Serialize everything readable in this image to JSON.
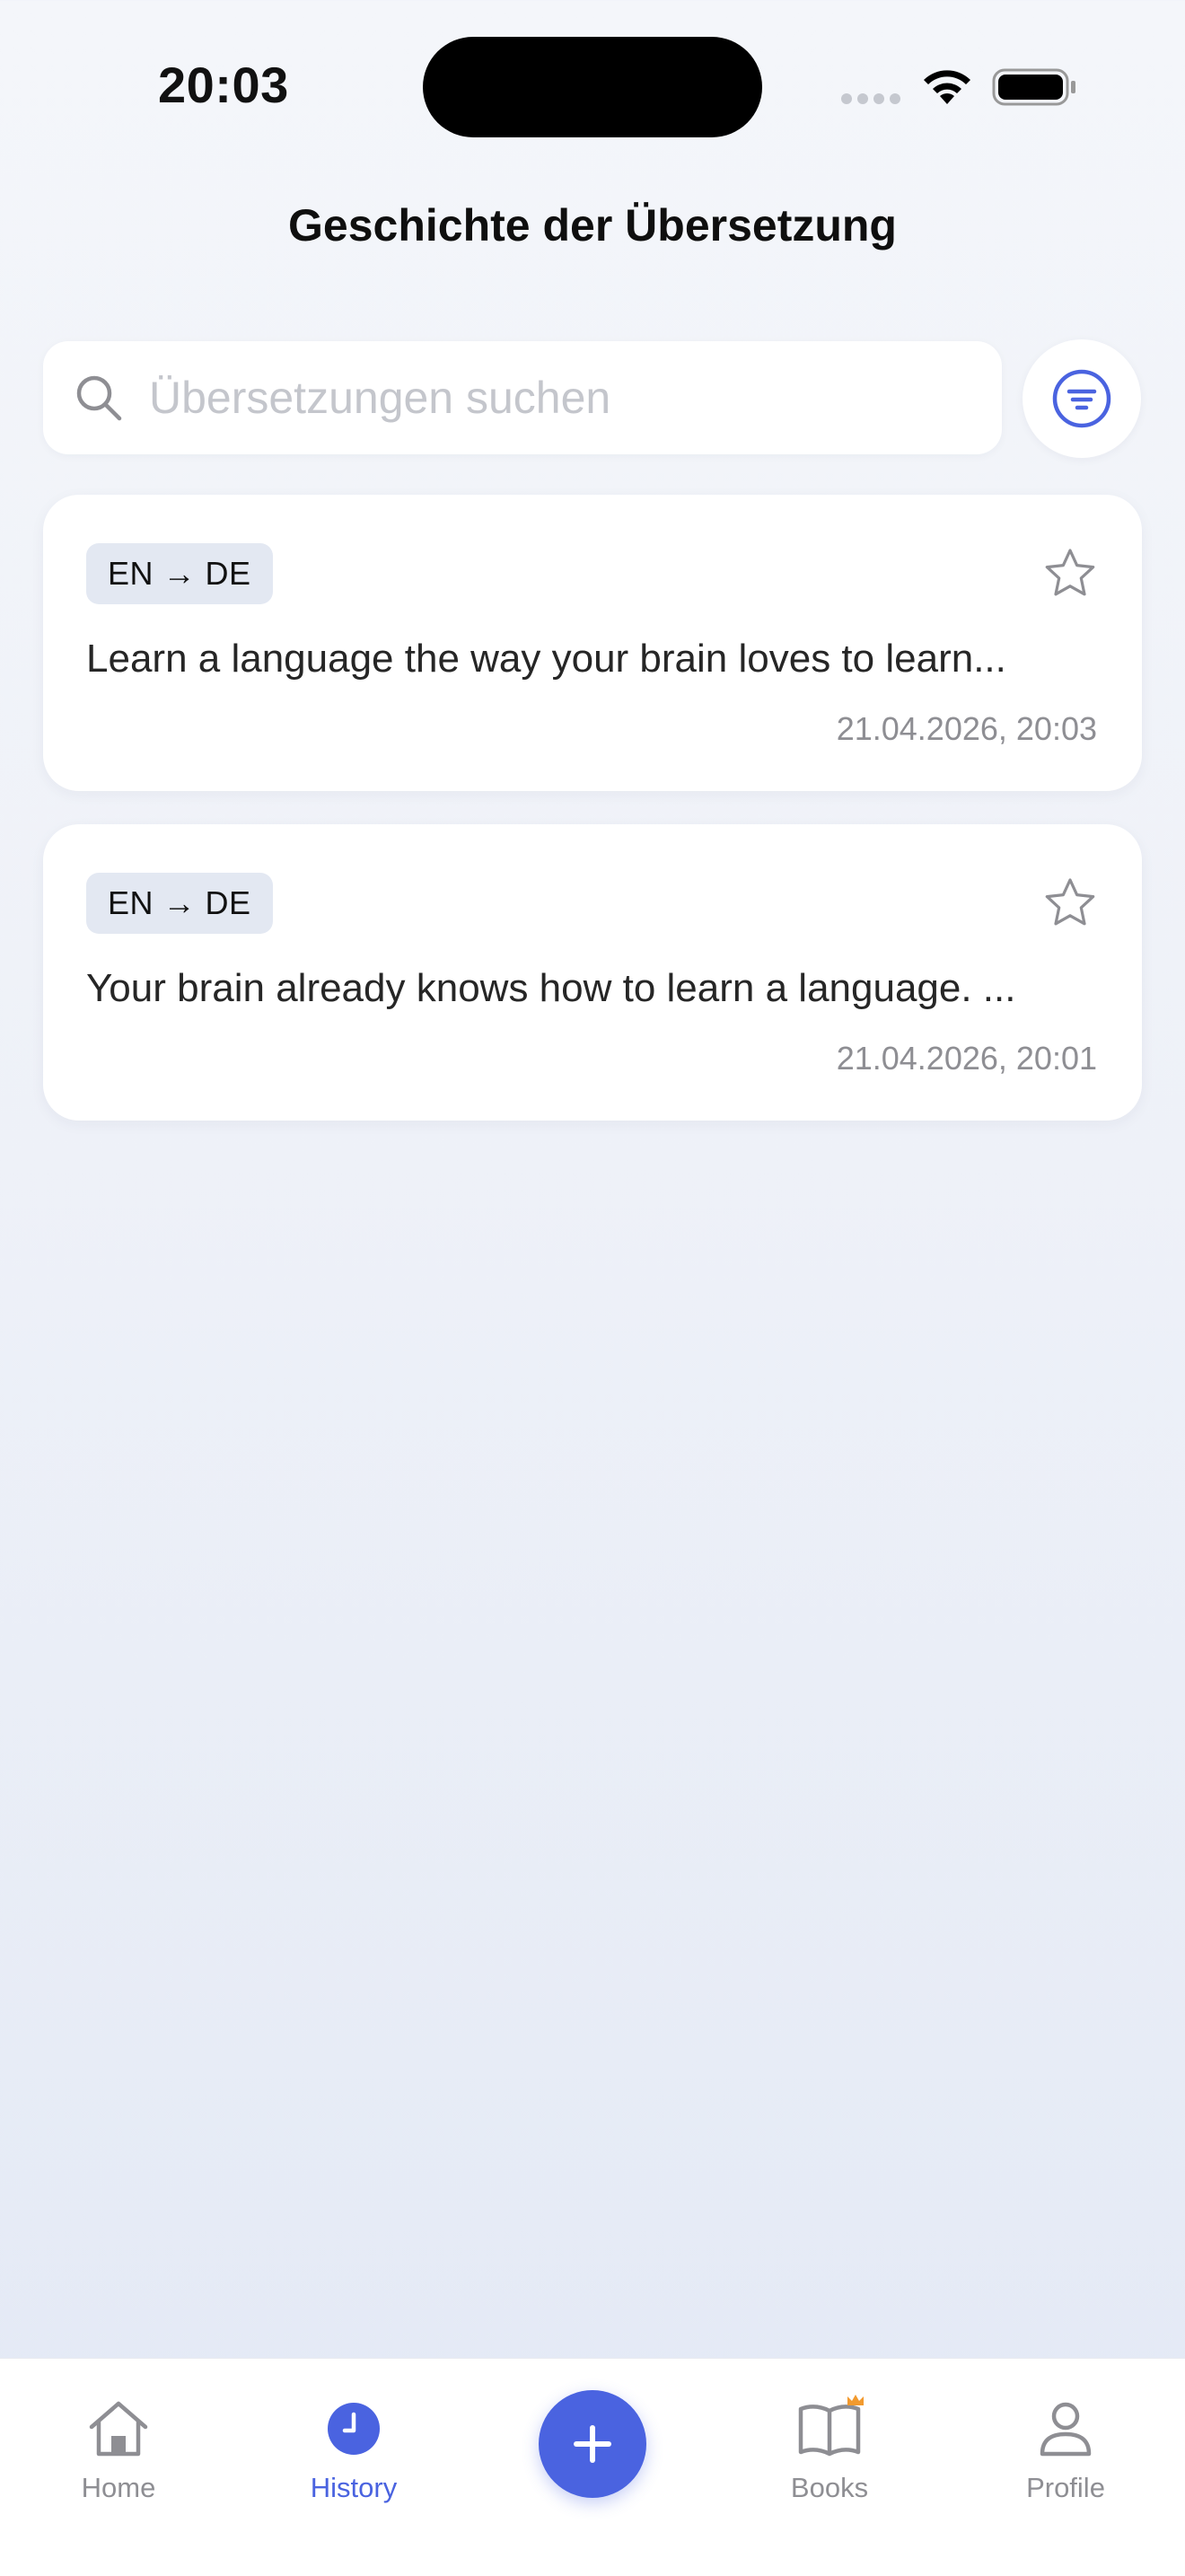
{
  "status_bar": {
    "time": "20:03"
  },
  "header": {
    "title": "Geschichte der Übersetzung"
  },
  "search": {
    "placeholder": "Übersetzungen suchen",
    "value": ""
  },
  "history_items": [
    {
      "lang_pair": "EN → DE",
      "text": "Learn a language the way your brain loves to learn...",
      "date": "21.04.2026, 20:03",
      "favorite": false
    },
    {
      "lang_pair": "EN → DE",
      "text": "Your brain already knows how to learn a language. ...",
      "date": "21.04.2026, 20:01",
      "favorite": false
    }
  ],
  "tab_bar": {
    "items": [
      {
        "label": "Home",
        "icon": "house-icon",
        "active": false
      },
      {
        "label": "History",
        "icon": "clock-icon",
        "active": true
      },
      {
        "label": "",
        "icon": "plus-icon",
        "active": false
      },
      {
        "label": "Books",
        "icon": "book-icon",
        "active": false,
        "badge_icon": "crown-icon"
      },
      {
        "label": "Profile",
        "icon": "person-icon",
        "active": false
      }
    ]
  },
  "colors": {
    "accent": "#4a63e0",
    "inactive": "#8e8e93",
    "badge_bg": "#e3e8f2",
    "crown": "#f29a2e"
  }
}
